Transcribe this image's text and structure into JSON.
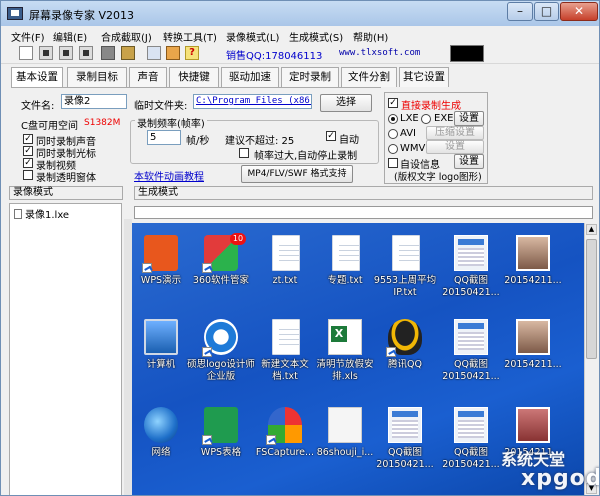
{
  "window": {
    "title": "屏幕录像专家 V2013",
    "minimize": "–",
    "maximize": "□",
    "close": "✕"
  },
  "menu": [
    "文件(F)",
    "编辑(E)",
    "合成截取(J)",
    "转换工具(T)",
    "录像模式(L)",
    "生成模式(S)",
    "帮助(H)"
  ],
  "toolbar": {
    "help_glyph": "?",
    "qq_text": "销售QQ:178046113",
    "site_text": "www.tlxsoft.com"
  },
  "tabs": [
    "基本设置",
    "录制目标",
    "声音",
    "快捷键",
    "驱动加速",
    "定时录制",
    "文件分割",
    "其它设置"
  ],
  "basic": {
    "filename_label": "文件名:",
    "filename_value": "录像2",
    "tempdir_label": "临时文件夹:",
    "tempdir_value": "C:\\Program Files (x86)\\",
    "select_button": "选择",
    "disk_label": "C盘可用空间",
    "disk_value": "S1382M",
    "opt_record_audio": "同时录制声音",
    "opt_record_cursor": "同时录制光标",
    "opt_record_video": "录制视频",
    "opt_record_transparent": "录制透明窗体",
    "fps_group_label": "录制频率(帧率)",
    "fps_value": "5",
    "fps_unit": "帧/秒",
    "fps_hint": "建议不超过: 25",
    "auto_label": "自动",
    "auto_stop_label": "帧率过大,自动停止录制",
    "tutorial_link": "本软件动画教程",
    "format_button": "MP4/FLV/SWF 格式支持"
  },
  "right_panel": {
    "direct_gen_label": "直接录制生成",
    "lxe_label": "LXE",
    "exe_label": "EXE",
    "setting_button": "设置",
    "avi_label": "AVI",
    "compress_button": "压缩设置",
    "wmv_label": "WMV",
    "settings2_button": "设置",
    "custom_info_label": "自设信息",
    "settings3_button": "设置",
    "copyright_note": "(版权文字 logo图形)"
  },
  "headers": {
    "record_mode": "录像模式",
    "gen_mode": "生成模式"
  },
  "recordings": [
    "录像1.lxe"
  ],
  "desktop_icons": [
    {
      "label": "WPS演示",
      "icon": "wps-presentation-icon"
    },
    {
      "label": "360软件管家",
      "icon": "360-manager-icon",
      "badge": "10"
    },
    {
      "label": "zt.txt",
      "icon": "text-file-icon"
    },
    {
      "label": "专题.txt",
      "icon": "text-file-icon"
    },
    {
      "label": "9553上周平均IP.txt",
      "icon": "text-file-icon"
    },
    {
      "label": "QQ截图20150421...",
      "icon": "screenshot-icon"
    },
    {
      "label": "20154211...",
      "icon": "photo-icon"
    },
    {
      "label": "计算机",
      "icon": "computer-icon"
    },
    {
      "label": "硕思logo设计师企业版",
      "icon": "logo-designer-icon"
    },
    {
      "label": "新建文本文档.txt",
      "icon": "text-file-icon"
    },
    {
      "label": "清明节放假安排.xls",
      "icon": "excel-file-icon"
    },
    {
      "label": "腾讯QQ",
      "icon": "qq-icon"
    },
    {
      "label": "QQ截图20150421...",
      "icon": "screenshot-icon"
    },
    {
      "label": "20154211...",
      "icon": "photo-icon"
    },
    {
      "label": "网络",
      "icon": "network-icon"
    },
    {
      "label": "WPS表格",
      "icon": "wps-spreadsheet-icon"
    },
    {
      "label": "FSCapture...",
      "icon": "fscapture-icon"
    },
    {
      "label": "86shouji_i...",
      "icon": "image-file-icon"
    },
    {
      "label": "QQ截图20150421...",
      "icon": "screenshot-icon"
    },
    {
      "label": "QQ截图20150421...",
      "icon": "screenshot-icon"
    },
    {
      "label": "20154211...",
      "icon": "photo-icon"
    }
  ],
  "watermark": {
    "line1": "系统天堂",
    "line2": "xpgod"
  }
}
